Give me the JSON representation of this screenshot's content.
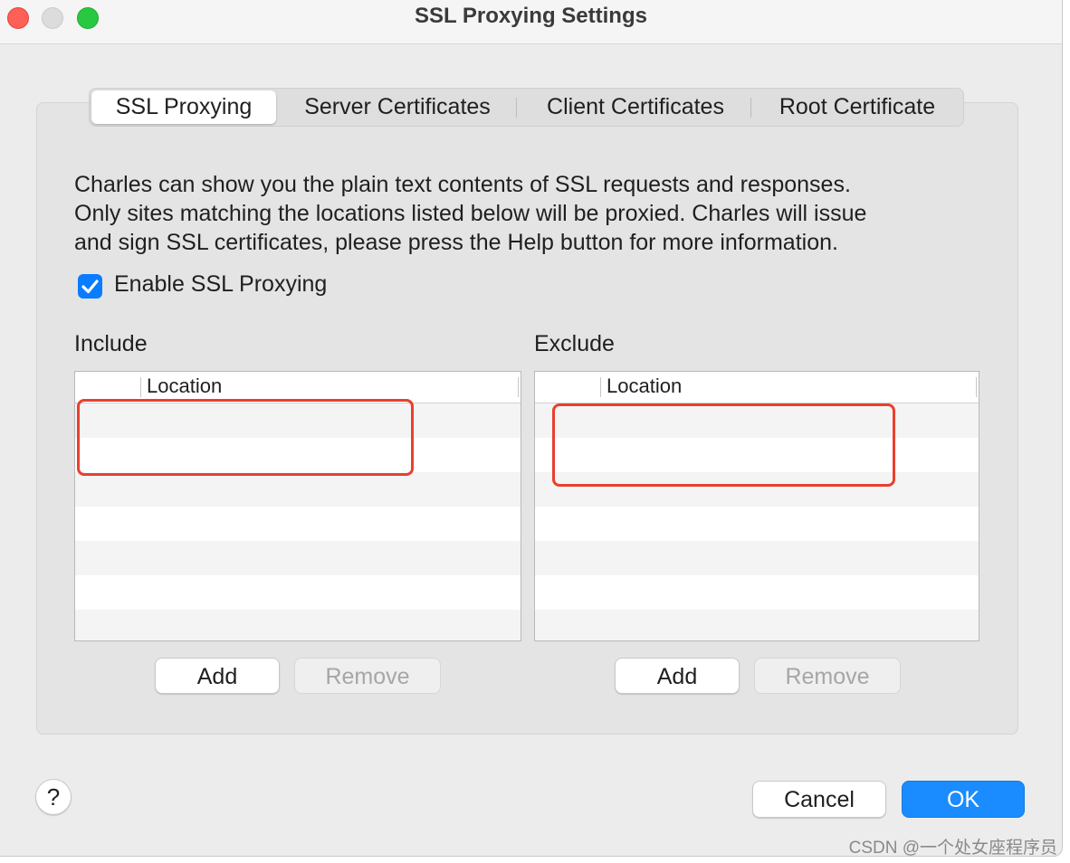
{
  "window": {
    "title": "SSL Proxying Settings"
  },
  "tabs": [
    {
      "label": "SSL Proxying",
      "active": true
    },
    {
      "label": "Server Certificates",
      "active": false
    },
    {
      "label": "Client Certificates",
      "active": false
    },
    {
      "label": "Root Certificate",
      "active": false
    }
  ],
  "description": {
    "line1": "Charles can show you the plain text contents of SSL requests and responses.",
    "line2": "Only sites matching the locations listed below will be proxied. Charles will issue",
    "line3": "and sign SSL certificates, please press the Help button for more information."
  },
  "enable_ssl": {
    "label": "Enable SSL Proxying",
    "checked": true,
    "checkmark": "✓"
  },
  "include": {
    "label": "Include",
    "column_header": "Location",
    "rows": [],
    "add_label": "Add",
    "remove_label": "Remove",
    "remove_enabled": false
  },
  "exclude": {
    "label": "Exclude",
    "column_header": "Location",
    "rows": [],
    "add_label": "Add",
    "remove_label": "Remove",
    "remove_enabled": false
  },
  "footer": {
    "help_label": "?",
    "cancel_label": "Cancel",
    "ok_label": "OK"
  },
  "watermark": "CSDN @一个处女座程序员",
  "colors": {
    "accent": "#1a8cff",
    "checkbox": "#0a7cff",
    "annotation": "#e8402e",
    "close": "#fe5f57",
    "zoom": "#28c840"
  }
}
